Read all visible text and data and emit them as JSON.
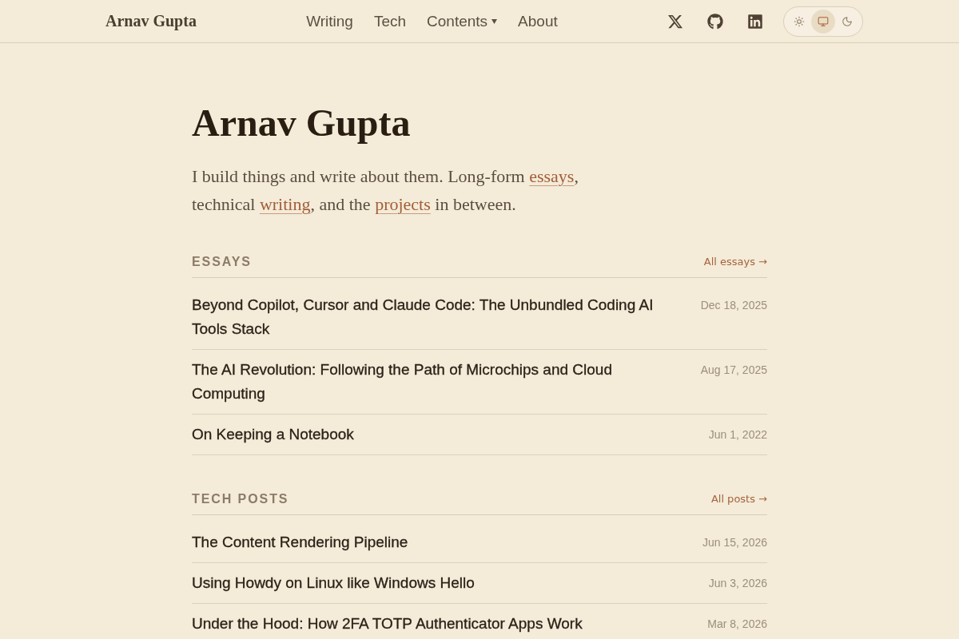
{
  "header": {
    "logo": "Arnav Gupta",
    "nav": [
      {
        "label": "Writing",
        "dropdown": false
      },
      {
        "label": "Tech",
        "dropdown": false
      },
      {
        "label": "Contents",
        "dropdown": true
      },
      {
        "label": "About",
        "dropdown": false
      }
    ],
    "theme_switcher": {
      "options": [
        {
          "kind": "light",
          "selected": false
        },
        {
          "kind": "system",
          "selected": true
        },
        {
          "kind": "dark",
          "selected": false
        }
      ]
    }
  },
  "hero": {
    "title": "Arnav Gupta",
    "intro": [
      {
        "kind": "text",
        "text": "I build things and write about them. Long-form "
      },
      {
        "kind": "link",
        "text": "essays"
      },
      {
        "kind": "text",
        "text": ", technical "
      },
      {
        "kind": "link",
        "text": "writing"
      },
      {
        "kind": "text",
        "text": ", and the "
      },
      {
        "kind": "link",
        "text": "projects"
      },
      {
        "kind": "text",
        "text": " in between."
      }
    ]
  },
  "sections": [
    {
      "heading": "ESSAYS",
      "more_link": "All essays →",
      "items": [
        {
          "title": "Beyond Copilot, Cursor and Claude Code: The Unbundled Coding AI Tools Stack",
          "date": "Dec 18, 2025"
        },
        {
          "title": "The AI Revolution: Following the Path of Microchips and Cloud Computing",
          "date": "Aug 17, 2025"
        },
        {
          "title": "On Keeping a Notebook",
          "date": "Jun 1, 2022"
        }
      ]
    },
    {
      "heading": "TECH POSTS",
      "more_link": "All posts →",
      "items": [
        {
          "title": "The Content Rendering Pipeline",
          "date": "Jun 15, 2026"
        },
        {
          "title": "Using Howdy on Linux like Windows Hello",
          "date": "Jun 3, 2026"
        },
        {
          "title": "Under the Hood: How 2FA TOTP Authenticator Apps Work",
          "date": "Mar 8, 2026"
        }
      ]
    }
  ]
}
